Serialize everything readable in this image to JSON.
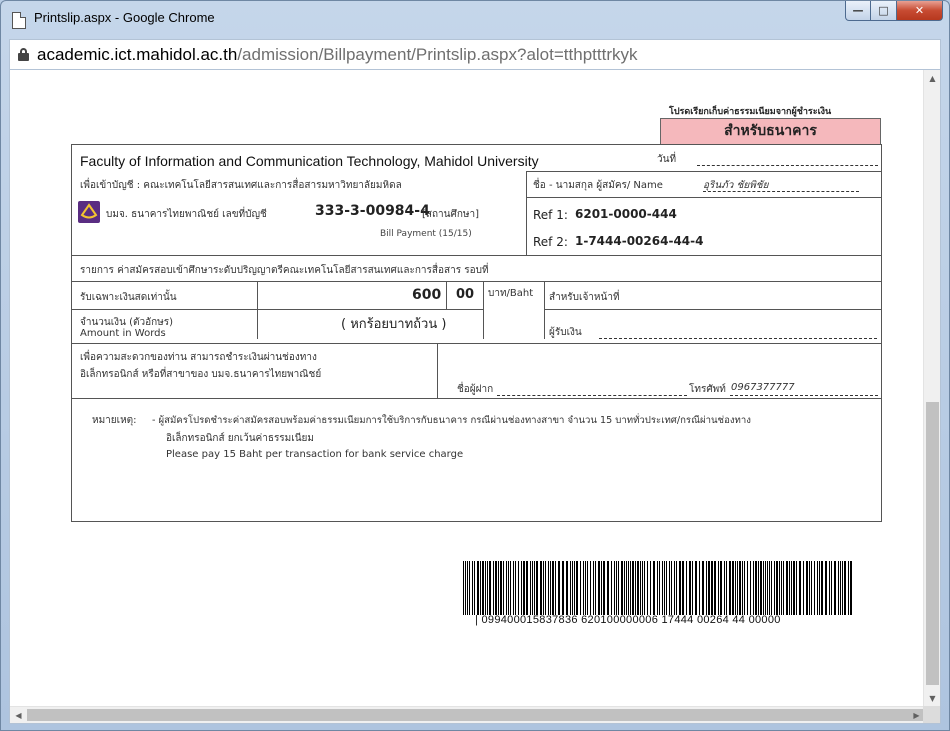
{
  "window": {
    "title": "Printslip.aspx - Google Chrome",
    "url_host": "academic.ict.mahidol.ac.th",
    "url_path": "/admission/Billpayment/Printslip.aspx?alot=tthptttrkyk"
  },
  "slip": {
    "notice": "โปรดเรียกเก็บค่าธรรมเนียมจากผู้ชำระเงิน",
    "bank_copy_label": "สำหรับธนาคาร",
    "faculty_name": "Faculty of Information and Communication Technology, Mahidol University",
    "date_label": "วันที่",
    "account_for": "เพื่อเข้าบัญชี : คณะเทคโนโลยีสารสนเทศและการสื่อสารมหาวิทยาลัยมหิดล",
    "bank_name_prefix": "บมจ. ธนาคารไทยพาณิชย์ เลขที่บัญชี",
    "account_number": "333-3-00984-4",
    "account_type": "[สถานศึกษา]",
    "bill_payment": "Bill Payment (15/15)",
    "applicant_label": "ชื่อ - นามสกุล ผู้สมัคร/ Name",
    "applicant_name": "อุรินภัว  ชัยพิชัย",
    "ref1_label": "Ref 1:",
    "ref1_value": "6201-0000-444",
    "ref2_label": "Ref 2:",
    "ref2_value": "1-7444-00264-44-4",
    "item_description": "รายการ ค่าสมัครสอบเข้าศึกษาระดับปริญญาตรีคณะเทคโนโลยีสารสนเทศและการสื่อสาร รอบที่",
    "cash_only": "รับเฉพาะเงินสดเท่านั้น",
    "amount_baht": "600",
    "amount_satang": "00",
    "currency_label": "บาท/Baht",
    "officer_label": "สำหรับเจ้าหน้าที่",
    "amount_words_th": "จำนวนเงิน (ตัวอักษร)",
    "amount_words_en": "Amount in Words",
    "amount_words_value": "( หกร้อยบาทถ้วน )",
    "receiver_label": "ผู้รับเงิน",
    "convenience_line1": "เพื่อความสะดวกของท่าน สามารถชำระเงินผ่านช่องทาง",
    "convenience_line2": "อิเล็กทรอนิกส์ หรือที่สาขาของ บมจ.ธนาคารไทยพาณิชย์",
    "depositor_label": "ชื่อผู้ฝาก",
    "phone_label": "โทรศัพท์",
    "phone_value": "0967377777",
    "remark_label": "หมายเหตุ:",
    "remark_line1": "- ผู้สมัครโปรดชำระค่าสมัครสอบพร้อมค่าธรรมเนียมการใช้บริการกับธนาคาร กรณีผ่านช่องทางสาขา จำนวน 15 บาททั่วประเทศ/กรณีผ่านช่องทาง",
    "remark_line2": "อิเล็กทรอนิกส์ ยกเว้นค่าธรรมเนียม",
    "remark_line3": "Please pay 15 Baht per transaction for bank service charge",
    "barcode_text": "| 099400015837836  620100000006  17444 00264 44  00000"
  },
  "colors": {
    "bank_copy_bg": "#f5b8bc",
    "scb_purple": "#5a2d82"
  },
  "icons": [
    "page-icon",
    "lock-icon",
    "minimize-icon",
    "maximize-icon",
    "close-icon",
    "scb-logo-icon"
  ]
}
